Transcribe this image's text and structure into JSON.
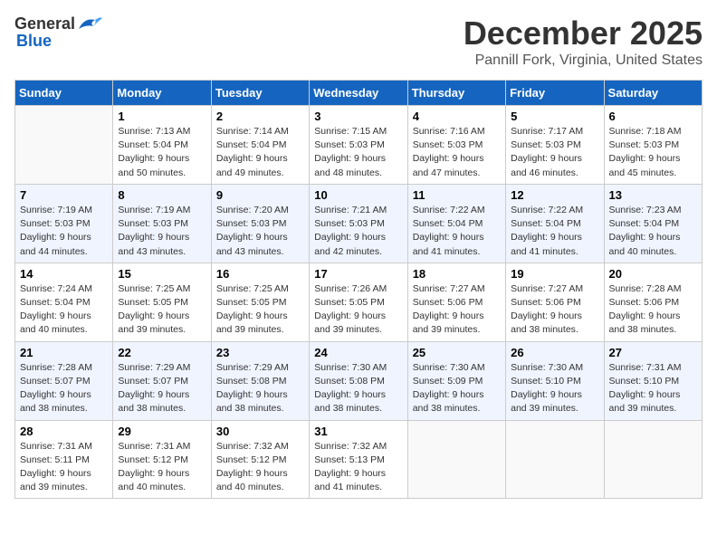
{
  "header": {
    "logo_general": "General",
    "logo_blue": "Blue",
    "month": "December 2025",
    "location": "Pannill Fork, Virginia, United States"
  },
  "days_of_week": [
    "Sunday",
    "Monday",
    "Tuesday",
    "Wednesday",
    "Thursday",
    "Friday",
    "Saturday"
  ],
  "weeks": [
    [
      {
        "day": "",
        "info": ""
      },
      {
        "day": "1",
        "info": "Sunrise: 7:13 AM\nSunset: 5:04 PM\nDaylight: 9 hours\nand 50 minutes."
      },
      {
        "day": "2",
        "info": "Sunrise: 7:14 AM\nSunset: 5:04 PM\nDaylight: 9 hours\nand 49 minutes."
      },
      {
        "day": "3",
        "info": "Sunrise: 7:15 AM\nSunset: 5:03 PM\nDaylight: 9 hours\nand 48 minutes."
      },
      {
        "day": "4",
        "info": "Sunrise: 7:16 AM\nSunset: 5:03 PM\nDaylight: 9 hours\nand 47 minutes."
      },
      {
        "day": "5",
        "info": "Sunrise: 7:17 AM\nSunset: 5:03 PM\nDaylight: 9 hours\nand 46 minutes."
      },
      {
        "day": "6",
        "info": "Sunrise: 7:18 AM\nSunset: 5:03 PM\nDaylight: 9 hours\nand 45 minutes."
      }
    ],
    [
      {
        "day": "7",
        "info": "Sunrise: 7:19 AM\nSunset: 5:03 PM\nDaylight: 9 hours\nand 44 minutes."
      },
      {
        "day": "8",
        "info": "Sunrise: 7:19 AM\nSunset: 5:03 PM\nDaylight: 9 hours\nand 43 minutes."
      },
      {
        "day": "9",
        "info": "Sunrise: 7:20 AM\nSunset: 5:03 PM\nDaylight: 9 hours\nand 43 minutes."
      },
      {
        "day": "10",
        "info": "Sunrise: 7:21 AM\nSunset: 5:03 PM\nDaylight: 9 hours\nand 42 minutes."
      },
      {
        "day": "11",
        "info": "Sunrise: 7:22 AM\nSunset: 5:04 PM\nDaylight: 9 hours\nand 41 minutes."
      },
      {
        "day": "12",
        "info": "Sunrise: 7:22 AM\nSunset: 5:04 PM\nDaylight: 9 hours\nand 41 minutes."
      },
      {
        "day": "13",
        "info": "Sunrise: 7:23 AM\nSunset: 5:04 PM\nDaylight: 9 hours\nand 40 minutes."
      }
    ],
    [
      {
        "day": "14",
        "info": "Sunrise: 7:24 AM\nSunset: 5:04 PM\nDaylight: 9 hours\nand 40 minutes."
      },
      {
        "day": "15",
        "info": "Sunrise: 7:25 AM\nSunset: 5:05 PM\nDaylight: 9 hours\nand 39 minutes."
      },
      {
        "day": "16",
        "info": "Sunrise: 7:25 AM\nSunset: 5:05 PM\nDaylight: 9 hours\nand 39 minutes."
      },
      {
        "day": "17",
        "info": "Sunrise: 7:26 AM\nSunset: 5:05 PM\nDaylight: 9 hours\nand 39 minutes."
      },
      {
        "day": "18",
        "info": "Sunrise: 7:27 AM\nSunset: 5:06 PM\nDaylight: 9 hours\nand 39 minutes."
      },
      {
        "day": "19",
        "info": "Sunrise: 7:27 AM\nSunset: 5:06 PM\nDaylight: 9 hours\nand 38 minutes."
      },
      {
        "day": "20",
        "info": "Sunrise: 7:28 AM\nSunset: 5:06 PM\nDaylight: 9 hours\nand 38 minutes."
      }
    ],
    [
      {
        "day": "21",
        "info": "Sunrise: 7:28 AM\nSunset: 5:07 PM\nDaylight: 9 hours\nand 38 minutes."
      },
      {
        "day": "22",
        "info": "Sunrise: 7:29 AM\nSunset: 5:07 PM\nDaylight: 9 hours\nand 38 minutes."
      },
      {
        "day": "23",
        "info": "Sunrise: 7:29 AM\nSunset: 5:08 PM\nDaylight: 9 hours\nand 38 minutes."
      },
      {
        "day": "24",
        "info": "Sunrise: 7:30 AM\nSunset: 5:08 PM\nDaylight: 9 hours\nand 38 minutes."
      },
      {
        "day": "25",
        "info": "Sunrise: 7:30 AM\nSunset: 5:09 PM\nDaylight: 9 hours\nand 38 minutes."
      },
      {
        "day": "26",
        "info": "Sunrise: 7:30 AM\nSunset: 5:10 PM\nDaylight: 9 hours\nand 39 minutes."
      },
      {
        "day": "27",
        "info": "Sunrise: 7:31 AM\nSunset: 5:10 PM\nDaylight: 9 hours\nand 39 minutes."
      }
    ],
    [
      {
        "day": "28",
        "info": "Sunrise: 7:31 AM\nSunset: 5:11 PM\nDaylight: 9 hours\nand 39 minutes."
      },
      {
        "day": "29",
        "info": "Sunrise: 7:31 AM\nSunset: 5:12 PM\nDaylight: 9 hours\nand 40 minutes."
      },
      {
        "day": "30",
        "info": "Sunrise: 7:32 AM\nSunset: 5:12 PM\nDaylight: 9 hours\nand 40 minutes."
      },
      {
        "day": "31",
        "info": "Sunrise: 7:32 AM\nSunset: 5:13 PM\nDaylight: 9 hours\nand 41 minutes."
      },
      {
        "day": "",
        "info": ""
      },
      {
        "day": "",
        "info": ""
      },
      {
        "day": "",
        "info": ""
      }
    ]
  ]
}
